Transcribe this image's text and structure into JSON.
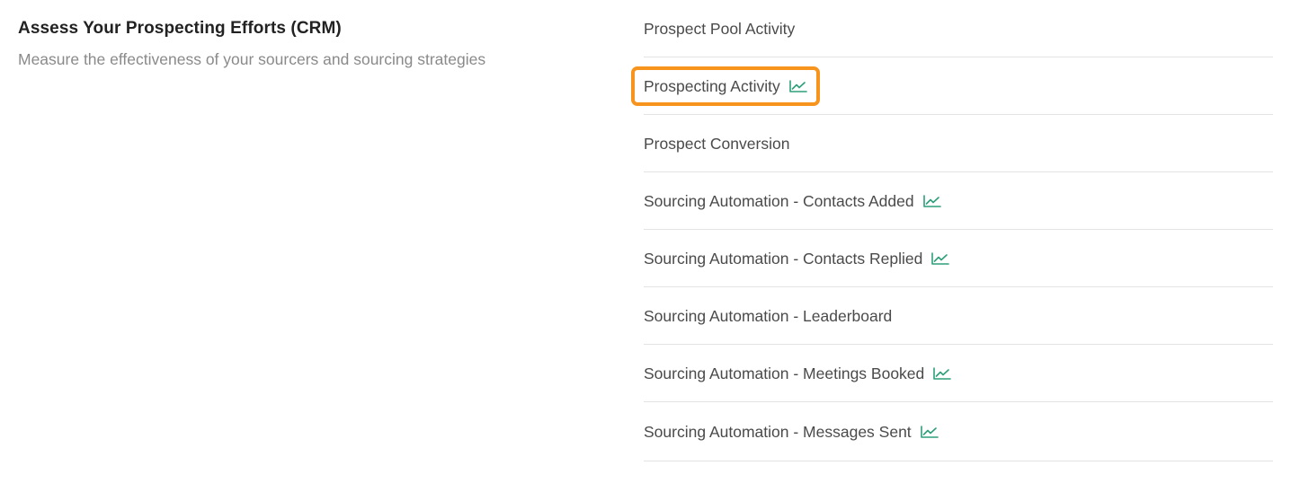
{
  "section": {
    "title": "Assess Your Prospecting Efforts (CRM)",
    "subtitle": "Measure the effectiveness of your sourcers and sourcing strategies"
  },
  "reports": [
    {
      "label": "Prospect Pool Activity",
      "has_trend_icon": false,
      "highlighted": false
    },
    {
      "label": "Prospecting Activity",
      "has_trend_icon": true,
      "highlighted": true
    },
    {
      "label": "Prospect Conversion",
      "has_trend_icon": false,
      "highlighted": false
    },
    {
      "label": "Sourcing Automation - Contacts Added",
      "has_trend_icon": true,
      "highlighted": false
    },
    {
      "label": "Sourcing Automation - Contacts Replied",
      "has_trend_icon": true,
      "highlighted": false
    },
    {
      "label": "Sourcing Automation - Leaderboard",
      "has_trend_icon": false,
      "highlighted": false
    },
    {
      "label": "Sourcing Automation - Meetings Booked",
      "has_trend_icon": true,
      "highlighted": false
    },
    {
      "label": "Sourcing Automation - Messages Sent",
      "has_trend_icon": true,
      "highlighted": false
    }
  ],
  "icons": {
    "trend": "chart-trend-icon"
  },
  "colors": {
    "highlight_outline": "#f7941d",
    "trend_icon": "#2e9e7a",
    "title_text": "#222222",
    "subtitle_text": "#8a8a8a",
    "item_text": "#4a4a4a",
    "divider": "#e3e3e3"
  }
}
